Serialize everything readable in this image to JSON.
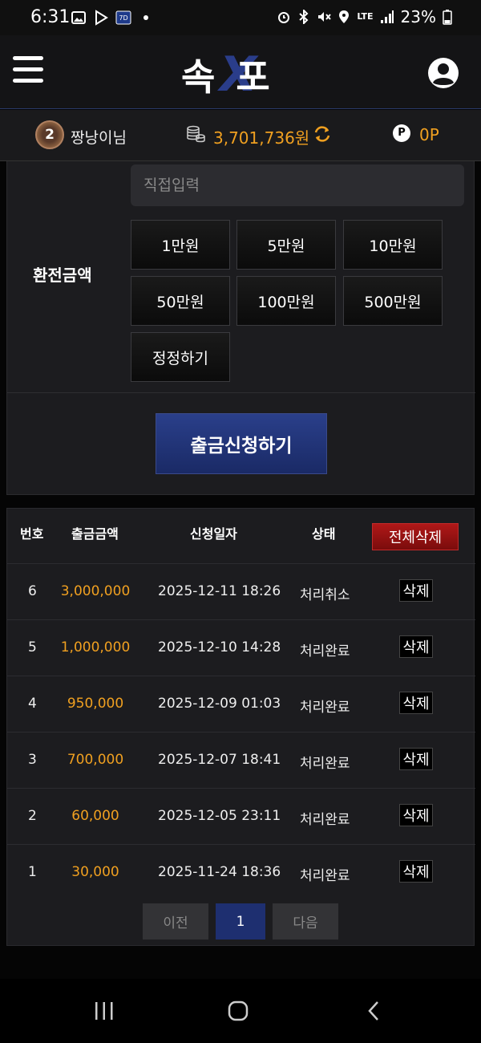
{
  "statusbar": {
    "time": "6:31",
    "battery": "23%",
    "network": "LTE"
  },
  "header": {
    "logo": "속X포",
    "logo_left": "속",
    "logo_x": "X",
    "logo_right": "포"
  },
  "user": {
    "level": "2",
    "name": "짱낭이님",
    "balance": "3,701,736원",
    "points": "0P",
    "point_badge": "P"
  },
  "form": {
    "input_placeholder": "직접입력",
    "amount_label": "환전금액",
    "amount_buttons": [
      "1만원",
      "5만원",
      "10만원",
      "50만원",
      "100만원",
      "500만원"
    ],
    "reset_label": "정정하기",
    "submit_label": "출금신청하기"
  },
  "table": {
    "headers": {
      "no": "번호",
      "amount": "출금금액",
      "date": "신청일자",
      "status": "상태"
    },
    "delete_all_label": "전체삭제",
    "delete_label": "삭제",
    "rows": [
      {
        "no": "6",
        "amount": "3,000,000",
        "date": "2025-12-11 18:26",
        "status": "처리취소"
      },
      {
        "no": "5",
        "amount": "1,000,000",
        "date": "2025-12-10 14:28",
        "status": "처리완료"
      },
      {
        "no": "4",
        "amount": "950,000",
        "date": "2025-12-09 01:03",
        "status": "처리완료"
      },
      {
        "no": "3",
        "amount": "700,000",
        "date": "2025-12-07 18:41",
        "status": "처리완료"
      },
      {
        "no": "2",
        "amount": "60,000",
        "date": "2025-12-05 23:11",
        "status": "처리완료"
      },
      {
        "no": "1",
        "amount": "30,000",
        "date": "2025-11-24 18:36",
        "status": "처리완료"
      }
    ]
  },
  "pagination": {
    "prev": "이전",
    "current": "1",
    "next": "다음"
  },
  "colors": {
    "accent_gold": "#f0a020",
    "brand_blue": "#1e2f70",
    "danger_red": "#a01414"
  }
}
